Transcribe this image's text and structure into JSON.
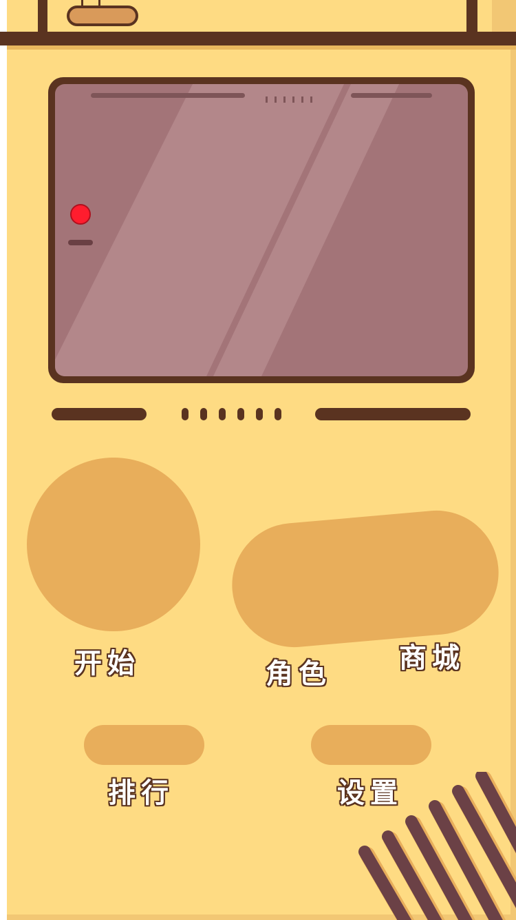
{
  "menu": {
    "start_label": "开始",
    "role_label": "角色",
    "shop_label": "商城",
    "rank_label": "排行",
    "settings_label": "设置"
  },
  "screen": {
    "indicator_dots": 6
  },
  "speaker": {
    "dots": 6
  },
  "icons": {
    "power_led": "red-led-icon",
    "cartridge": "cartridge-icon",
    "speaker_grille": "speaker-grille-icon"
  },
  "colors": {
    "body": "#fedb83",
    "outline": "#5a3320",
    "screen": "#a37478",
    "button": "#e8ae5b",
    "led": "#ff1d2e",
    "grille": "#6b4146"
  }
}
